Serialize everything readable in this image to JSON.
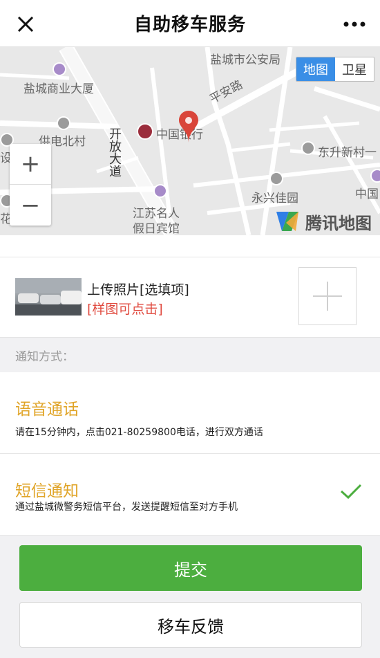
{
  "header": {
    "title": "自助移车服务",
    "close_icon": "close-icon",
    "more_icon": "more-icon"
  },
  "map": {
    "toggle": {
      "map_label": "地图",
      "satellite_label": "卫星",
      "active": "map"
    },
    "labels": {
      "yancheng_police": "盐城市公安局",
      "commerce_building": "盐城商业大厦",
      "pingan_road": "平安路",
      "power_north": "供电北村",
      "kaifang_avenue": "开放大道",
      "bank_of_china": "中国银行",
      "dongsheng_village": "东升新村一",
      "yongxing_garden": "永兴佳园",
      "zhongguo_partial": "中国",
      "jiangsu_hotel_line1": "江苏名人",
      "jiangsu_hotel_line2": "假日宾馆",
      "left_edge_1": "设立",
      "left_edge_2": "花"
    },
    "zoom_in": "+",
    "zoom_out": "−",
    "brand": "腾讯地图",
    "accent_color": "#3a8ee6"
  },
  "upload": {
    "title": "上传照片[选填项]",
    "hint": "[样图可点击]",
    "add_icon": "plus-icon"
  },
  "notify": {
    "section_label": "通知方式：",
    "voice": {
      "name": "语音通话",
      "description": "请在15分钟内，点击021-80259800电话，进行双方通话"
    },
    "sms": {
      "name": "短信通知",
      "description": "通过盐城微警务短信平台，发送提醒短信至对方手机",
      "selected": true
    },
    "accent_color": "#e0a427"
  },
  "actions": {
    "submit": "提交",
    "feedback": "移车反馈",
    "submit_color": "#4cae3f"
  }
}
